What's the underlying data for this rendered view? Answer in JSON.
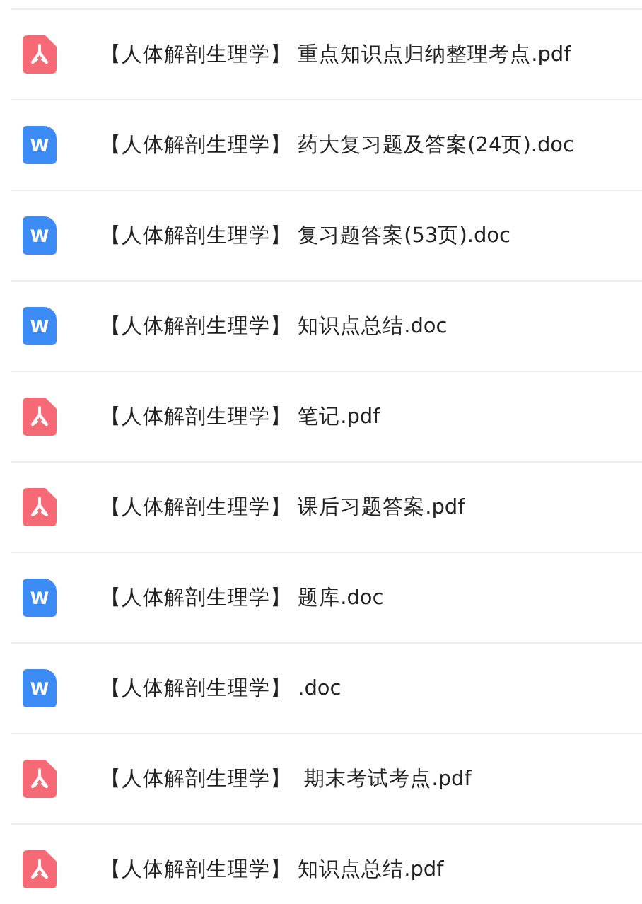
{
  "files": [
    {
      "kind": "pdf",
      "name": "【人体解剖生理学】 重点知识点归纳整理考点.pdf"
    },
    {
      "kind": "doc",
      "letter": "W",
      "name": "【人体解剖生理学】 药大复习题及答案(24页).doc"
    },
    {
      "kind": "doc",
      "letter": "W",
      "name": "【人体解剖生理学】 复习题答案(53页).doc"
    },
    {
      "kind": "doc",
      "letter": "W",
      "name": "【人体解剖生理学】 知识点总结.doc"
    },
    {
      "kind": "pdf",
      "name": "【人体解剖生理学】 笔记.pdf"
    },
    {
      "kind": "pdf",
      "name": "【人体解剖生理学】 课后习题答案.pdf"
    },
    {
      "kind": "doc",
      "letter": "W",
      "name": "【人体解剖生理学】 题库.doc"
    },
    {
      "kind": "doc",
      "letter": "W",
      "name": "【人体解剖生理学】 .doc"
    },
    {
      "kind": "pdf",
      "name": "【人体解剖生理学】  期末考试考点.pdf"
    },
    {
      "kind": "pdf",
      "name": "【人体解剖生理学】 知识点总结.pdf"
    }
  ]
}
